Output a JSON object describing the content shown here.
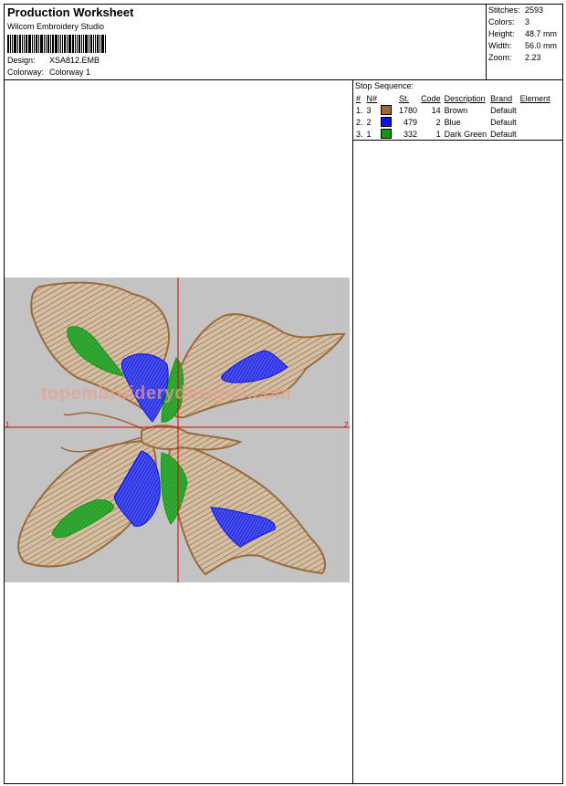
{
  "header": {
    "title": "Production Worksheet",
    "software": "Wilcom Embroidery Studio",
    "design_label": "Design:",
    "design_value": "XSA812.EMB",
    "colorway_label": "Colorway:",
    "colorway_value": "Colorway 1"
  },
  "stats": [
    {
      "label": "Stitches:",
      "value": "2593"
    },
    {
      "label": "Colors:",
      "value": "3"
    },
    {
      "label": "Height:",
      "value": "48.7 mm"
    },
    {
      "label": "Width:",
      "value": "56.0 mm"
    },
    {
      "label": "Zoom:",
      "value": "2.23"
    }
  ],
  "stop_sequence": {
    "title": "Stop Sequence:",
    "columns": [
      "#",
      "N#",
      "St.",
      "Code",
      "Description",
      "Brand",
      "Element"
    ],
    "rows": [
      {
        "num": "1.",
        "n": "3",
        "color": "#9b6a3b",
        "st": "1780",
        "code": "14",
        "desc": "Brown",
        "brand": "Default",
        "element": ""
      },
      {
        "num": "2.",
        "n": "2",
        "color": "#0b14e6",
        "st": "479",
        "code": "2",
        "desc": "Blue",
        "brand": "Default",
        "element": ""
      },
      {
        "num": "3.",
        "n": "1",
        "color": "#119711",
        "st": "332",
        "code": "1",
        "desc": "Dark Green",
        "brand": "Default",
        "element": ""
      }
    ]
  },
  "design": {
    "watermark": "topembroiderydesigns.com",
    "axis_left": "1",
    "axis_right": "2",
    "background": "#c3c3c3",
    "crosshair_color": "#e00000",
    "thread_colors": {
      "brown": "#9b6a3b",
      "blue": "#0b14e6",
      "green": "#119711"
    }
  }
}
